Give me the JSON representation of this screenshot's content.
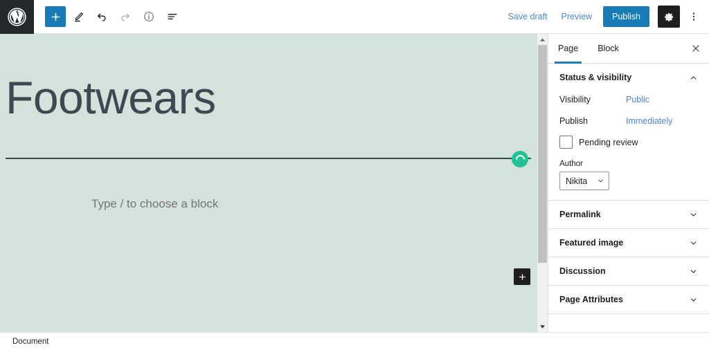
{
  "app": {
    "name": "WordPress Block Editor",
    "logo_icon": "wordpress-logo-icon"
  },
  "toolbar": {
    "add_block": {
      "label": "+",
      "icon": "plus-icon",
      "title": "Add block"
    },
    "tools": [
      {
        "name": "edit-tool",
        "icon": "pencil-icon",
        "title": "Tools",
        "disabled": false
      },
      {
        "name": "undo",
        "icon": "undo-arrow-icon",
        "title": "Undo",
        "disabled": false
      },
      {
        "name": "redo",
        "icon": "redo-arrow-icon",
        "title": "Redo",
        "disabled": true
      },
      {
        "name": "details",
        "icon": "info-circle-icon",
        "title": "Details",
        "disabled": false
      },
      {
        "name": "list-view",
        "icon": "list-view-icon",
        "title": "List view",
        "disabled": false
      }
    ],
    "save_draft_label": "Save draft",
    "preview_label": "Preview",
    "publish_label": "Publish",
    "settings_icon": "gear-icon",
    "more_options_icon": "kebab-menu-icon",
    "accent_blue": "#1a7bb9",
    "link_blue": "#4d87c7"
  },
  "canvas": {
    "background_color": "#d4e2dc",
    "post_title": "Footwears",
    "block_placeholder": "Type / to choose a block",
    "spinner": {
      "icon": "loading-spinner-icon",
      "color": "#22c296"
    },
    "inserter": {
      "icon": "plus-icon",
      "label": "+"
    }
  },
  "sidebar": {
    "tabs": [
      {
        "label": "Page",
        "active": true
      },
      {
        "label": "Block",
        "active": false
      }
    ],
    "close_icon": "close-icon",
    "panels": [
      {
        "title": "Status & visibility",
        "expanded": true,
        "chevron_icon": "chevron-up-icon",
        "rows": [
          {
            "label": "Visibility",
            "value": "Public"
          },
          {
            "label": "Publish",
            "value": "Immediately"
          }
        ],
        "pending_review_label": "Pending review",
        "pending_review_checked": false,
        "author_label": "Author",
        "author_value": "Nikita",
        "author_chevron_icon": "chevron-down-icon"
      },
      {
        "title": "Permalink",
        "expanded": false,
        "chevron_icon": "chevron-down-icon"
      },
      {
        "title": "Featured image",
        "expanded": false,
        "chevron_icon": "chevron-down-icon"
      },
      {
        "title": "Discussion",
        "expanded": false,
        "chevron_icon": "chevron-down-icon"
      },
      {
        "title": "Page Attributes",
        "expanded": false,
        "chevron_icon": "chevron-down-icon"
      }
    ]
  },
  "scrollbar": {
    "up_icon": "scroll-up-arrow-icon",
    "down_icon": "scroll-down-arrow-icon"
  },
  "statusbar": {
    "breadcrumb": "Document"
  }
}
